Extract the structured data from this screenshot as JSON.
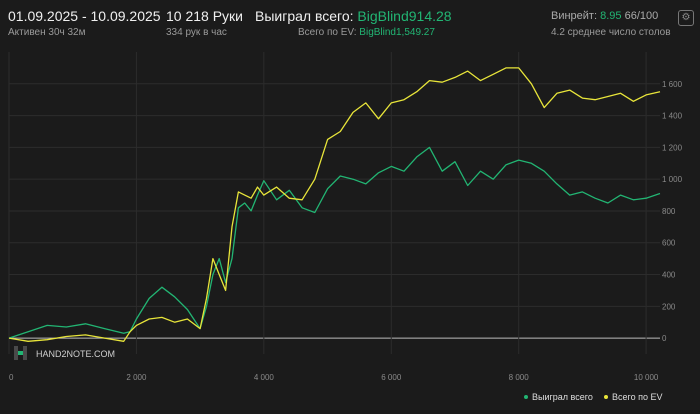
{
  "header": {
    "date_range": "01.09.2025 - 10.09.2025",
    "active": "Активен 30ч 32м",
    "hands": "10 218 Руки",
    "hands_per_hour": "334 рук в час",
    "won_label": "Выиграл всего:",
    "won_value": "BigBlind914.28",
    "ev_label": "Всего по EV:",
    "ev_value": "BigBlind1,549.27",
    "winrate_label": "Винрейт:",
    "winrate_value": "8.95",
    "winrate_extra": "66/100",
    "tables": "4.2 среднее число столов"
  },
  "watermark": "HAND2NOTE.COM",
  "colors": {
    "won": "#22b573",
    "ev": "#e8e53a",
    "grid": "#2c2c2c",
    "zero": "#bdbdbd"
  },
  "icons": {
    "settings": "gear-icon"
  },
  "chart_data": {
    "type": "line",
    "xlim": [
      0,
      10218
    ],
    "ylim": [
      -100,
      1800
    ],
    "xticks": [
      0,
      2000,
      4000,
      6000,
      8000,
      10000
    ],
    "xtick_labels": [
      "0",
      "2 000",
      "4 000",
      "6 000",
      "8 000",
      "10 000"
    ],
    "yticks": [
      0,
      200,
      400,
      600,
      800,
      1000,
      1200,
      1400,
      1600
    ],
    "ytick_labels": [
      "0",
      "200",
      "400",
      "600",
      "800",
      "1 000",
      "1 200",
      "1 400",
      "1 600"
    ],
    "legend": "bottom-right",
    "series": [
      {
        "name": "Выиграл всего",
        "color": "#22b573",
        "x": [
          0,
          300,
          600,
          900,
          1200,
          1500,
          1800,
          1900,
          2000,
          2200,
          2400,
          2600,
          2800,
          3000,
          3100,
          3200,
          3300,
          3400,
          3500,
          3600,
          3700,
          3800,
          3900,
          4000,
          4200,
          4400,
          4600,
          4800,
          5000,
          5200,
          5400,
          5600,
          5800,
          6000,
          6200,
          6400,
          6600,
          6800,
          7000,
          7200,
          7400,
          7600,
          7800,
          8000,
          8200,
          8400,
          8600,
          8800,
          9000,
          9200,
          9400,
          9600,
          9800,
          10000,
          10218
        ],
        "y": [
          0,
          40,
          80,
          70,
          90,
          60,
          30,
          40,
          120,
          250,
          320,
          260,
          180,
          60,
          200,
          400,
          500,
          350,
          500,
          820,
          850,
          800,
          900,
          990,
          870,
          930,
          820,
          790,
          940,
          1020,
          1000,
          970,
          1040,
          1080,
          1050,
          1140,
          1200,
          1050,
          1110,
          960,
          1050,
          1000,
          1090,
          1120,
          1100,
          1050,
          970,
          900,
          920,
          880,
          850,
          900,
          870,
          880,
          910
        ]
      },
      {
        "name": "Всего по EV",
        "color": "#e8e53a",
        "x": [
          0,
          300,
          600,
          900,
          1200,
          1500,
          1800,
          1900,
          2000,
          2200,
          2400,
          2600,
          2800,
          3000,
          3100,
          3200,
          3300,
          3400,
          3500,
          3600,
          3700,
          3800,
          3900,
          4000,
          4200,
          4400,
          4600,
          4800,
          5000,
          5200,
          5400,
          5600,
          5800,
          6000,
          6200,
          6400,
          6600,
          6800,
          7000,
          7200,
          7400,
          7600,
          7800,
          8000,
          8200,
          8400,
          8600,
          8800,
          9000,
          9200,
          9400,
          9600,
          9800,
          10000,
          10218
        ],
        "y": [
          0,
          -20,
          -10,
          10,
          20,
          0,
          -20,
          40,
          80,
          120,
          130,
          100,
          120,
          60,
          250,
          500,
          400,
          300,
          700,
          920,
          900,
          880,
          950,
          900,
          950,
          880,
          870,
          1000,
          1250,
          1300,
          1420,
          1480,
          1380,
          1480,
          1500,
          1550,
          1620,
          1610,
          1640,
          1680,
          1620,
          1660,
          1700,
          1700,
          1600,
          1450,
          1540,
          1560,
          1510,
          1500,
          1520,
          1540,
          1490,
          1530,
          1550
        ]
      }
    ]
  }
}
